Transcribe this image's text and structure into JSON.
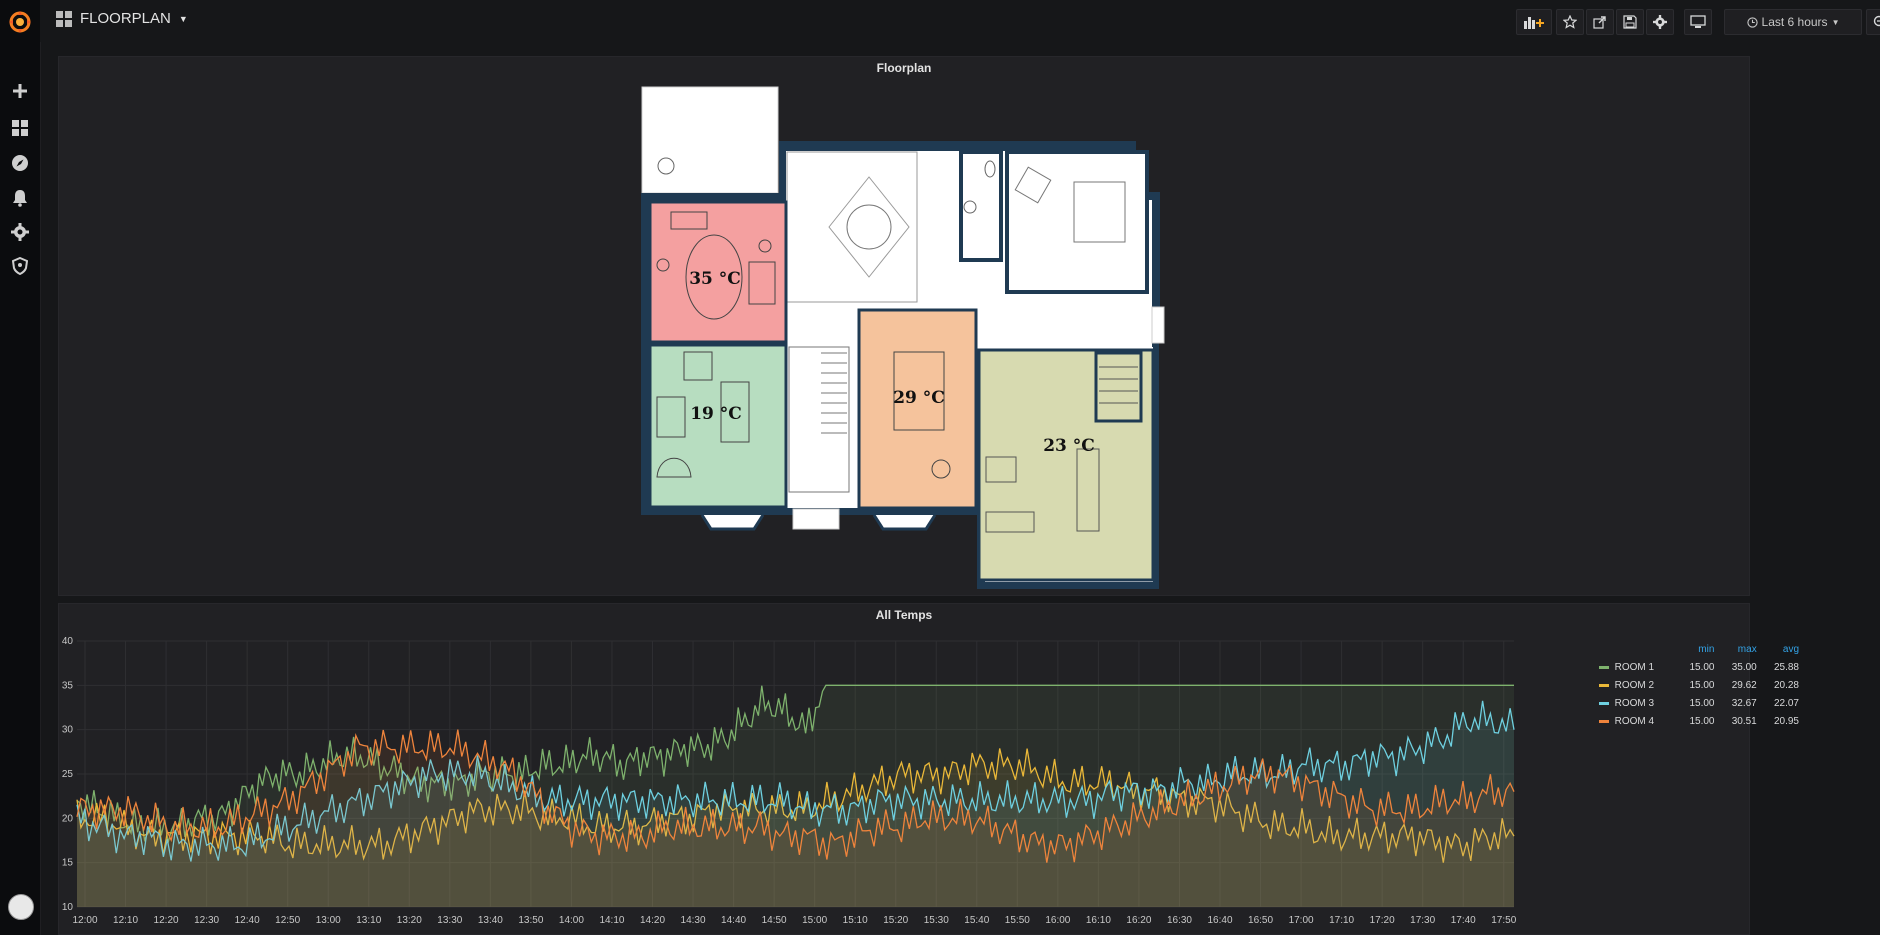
{
  "app": {
    "dashboard_title": "FLOORPLAN",
    "time_range": "Last 6 hours"
  },
  "sidebar": {
    "items": [
      {
        "icon": "plus-icon"
      },
      {
        "icon": "dashboards-icon"
      },
      {
        "icon": "compass-icon"
      },
      {
        "icon": "bell-icon"
      },
      {
        "icon": "gear-icon"
      },
      {
        "icon": "shield-icon"
      }
    ]
  },
  "toolbar": {
    "buttons": [
      "add-panel-icon",
      "star-icon",
      "share-icon",
      "save-icon",
      "gear-icon",
      "tv-icon",
      "zoom-out-icon",
      "refresh-icon"
    ]
  },
  "floorplan_panel": {
    "title": "Floorplan",
    "rooms": [
      {
        "temp": "35 °C",
        "color": "#f4a0a0"
      },
      {
        "temp": "19 °C",
        "color": "#b7ddc0"
      },
      {
        "temp": "29 °C",
        "color": "#f5c39c"
      },
      {
        "temp": "23 °C",
        "color": "#d7dab0"
      }
    ]
  },
  "chart_panel": {
    "title": "All Temps",
    "legend_headers": {
      "min": "min",
      "max": "max",
      "avg": "avg"
    }
  },
  "chart_data": {
    "type": "line",
    "title": "All Temps",
    "ylim": [
      10,
      40
    ],
    "yticks": [
      10,
      15,
      20,
      25,
      30,
      35,
      40
    ],
    "xticks": [
      "12:00",
      "12:10",
      "12:20",
      "12:30",
      "12:40",
      "12:50",
      "13:00",
      "13:10",
      "13:20",
      "13:30",
      "13:40",
      "13:50",
      "14:00",
      "14:10",
      "14:20",
      "14:30",
      "14:40",
      "14:50",
      "15:00",
      "15:10",
      "15:20",
      "15:30",
      "15:40",
      "15:50",
      "16:00",
      "16:10",
      "16:20",
      "16:30",
      "16:40",
      "16:50",
      "17:00",
      "17:10",
      "17:20",
      "17:30",
      "17:40",
      "17:50"
    ],
    "grid": true,
    "legend_position": "right",
    "series": [
      {
        "name": "ROOM 1",
        "color": "#7eb26d",
        "min": "15.00",
        "max": "35.00",
        "avg": "25.88",
        "values": [
          22,
          21,
          20,
          19,
          19,
          19,
          20,
          20,
          22,
          24,
          25,
          25,
          26,
          27,
          27,
          26,
          25,
          24,
          24,
          24,
          25,
          25,
          25,
          26,
          26,
          27,
          27,
          26,
          27,
          27,
          28,
          28,
          29,
          31,
          33,
          32,
          30,
          35,
          35,
          35,
          35,
          35,
          35,
          35,
          35,
          35,
          35,
          35,
          35,
          35,
          35,
          35,
          35,
          35,
          35,
          35,
          35,
          35,
          35,
          35,
          35,
          35,
          35,
          35,
          35,
          35,
          35,
          35,
          35,
          35,
          35,
          35
        ]
      },
      {
        "name": "ROOM 2",
        "color": "#eab839",
        "min": "15.00",
        "max": "29.62",
        "avg": "20.28",
        "values": [
          20,
          20,
          19,
          18,
          18,
          18,
          18,
          18,
          18,
          17,
          17,
          17,
          17,
          17,
          18,
          19,
          20,
          21,
          21,
          21,
          20,
          20,
          19,
          19,
          19,
          20,
          20,
          21,
          21,
          21,
          21,
          21,
          22,
          23,
          24,
          25,
          25,
          25,
          26,
          26,
          26,
          25,
          24,
          24,
          24,
          23,
          23,
          22,
          22,
          21,
          20,
          19,
          19,
          18,
          18,
          18,
          18,
          18,
          17,
          17,
          18,
          18
        ]
      },
      {
        "name": "ROOM 3",
        "color": "#6ed0e0",
        "min": "15.00",
        "max": "32.67",
        "avg": "22.07",
        "values": [
          20,
          19,
          18,
          18,
          17,
          17,
          17,
          17,
          18,
          19,
          20,
          21,
          22,
          23,
          24,
          25,
          25,
          25,
          24,
          23,
          22,
          22,
          22,
          22,
          22,
          22,
          22,
          22,
          22,
          22,
          22,
          21,
          21,
          21,
          22,
          22,
          22,
          22,
          22,
          22,
          22,
          22,
          22,
          22,
          23,
          23,
          23,
          24,
          24,
          25,
          25,
          25,
          26,
          26,
          26,
          27,
          27,
          28,
          29,
          31,
          31,
          30
        ]
      },
      {
        "name": "ROOM 4",
        "color": "#ef843c",
        "min": "15.00",
        "max": "30.51",
        "avg": "20.95",
        "values": [
          21,
          21,
          21,
          20,
          19,
          19,
          19,
          20,
          21,
          22,
          24,
          26,
          28,
          28,
          28,
          28,
          28,
          27,
          26,
          24,
          21,
          19,
          18,
          18,
          18,
          19,
          19,
          19,
          19,
          19,
          18,
          18,
          17,
          18,
          19,
          19,
          20,
          20,
          20,
          19,
          18,
          17,
          17,
          18,
          19,
          20,
          21,
          22,
          23,
          24,
          25,
          25,
          24,
          23,
          22,
          21,
          21,
          21,
          22,
          22,
          23,
          23
        ]
      }
    ]
  }
}
